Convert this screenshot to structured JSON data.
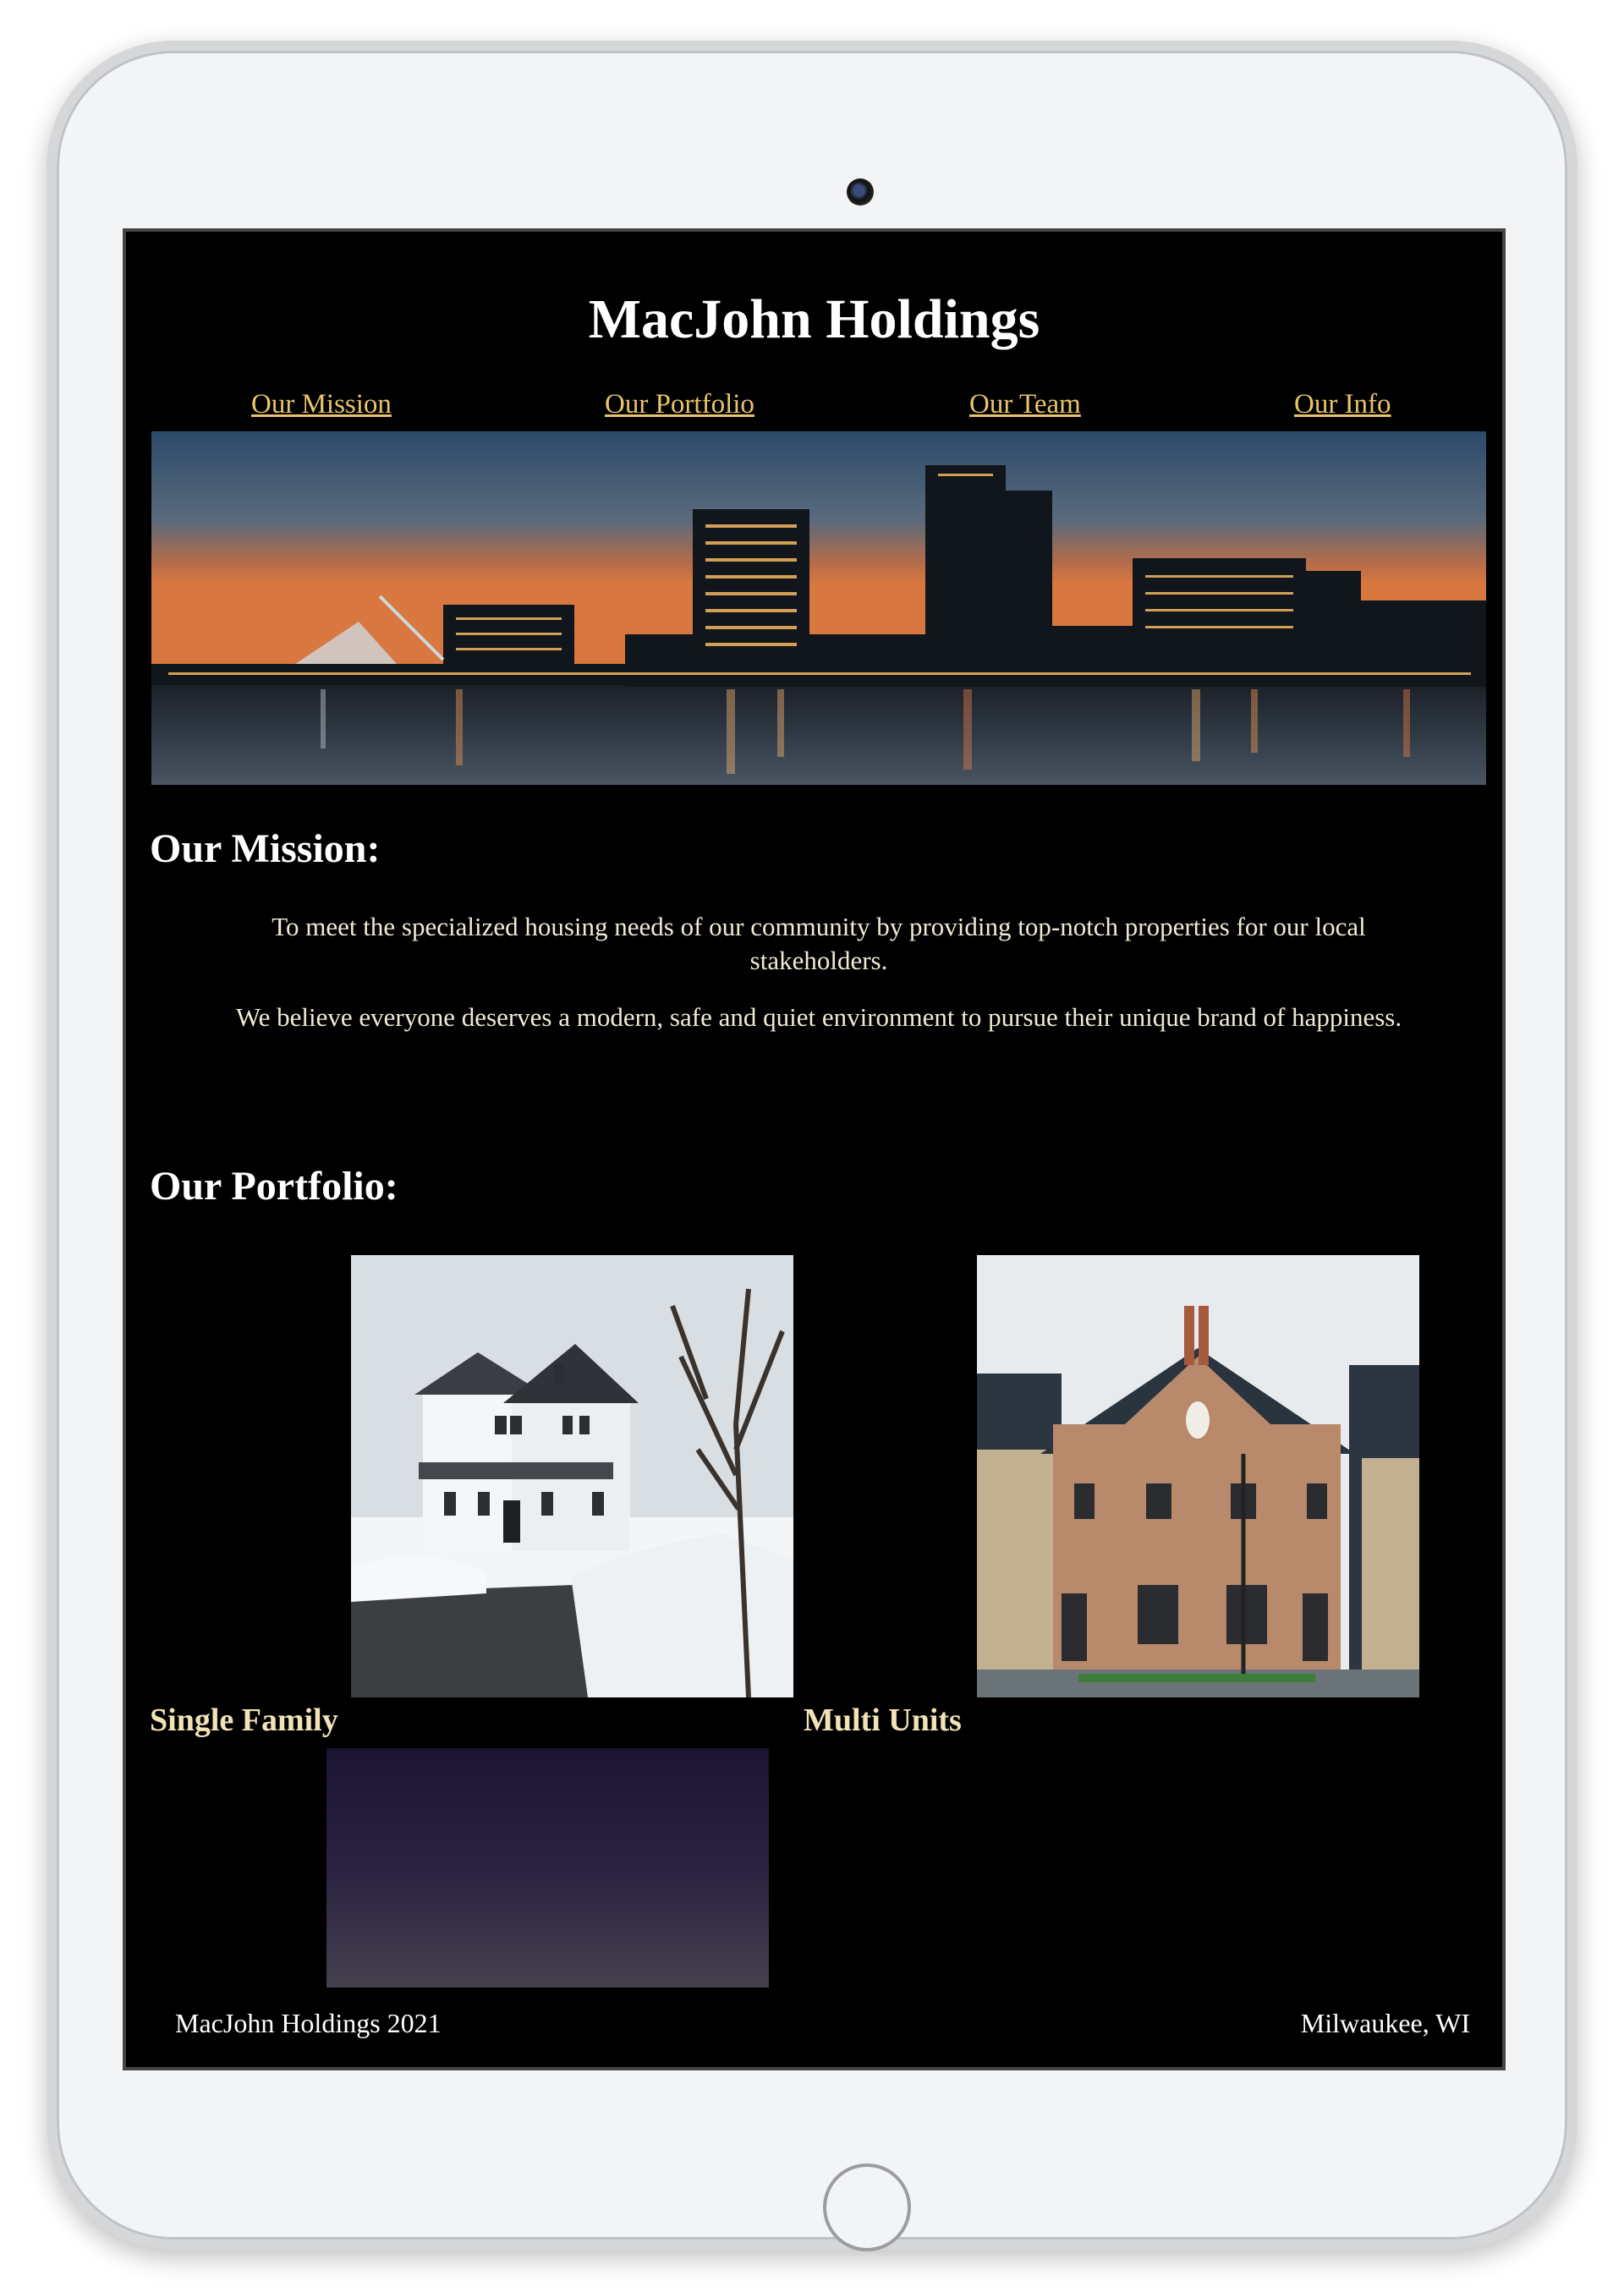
{
  "site": {
    "title": "MacJohn Holdings"
  },
  "nav": {
    "items": [
      {
        "label": "Our Mission"
      },
      {
        "label": "Our Portfolio"
      },
      {
        "label": "Our Team"
      },
      {
        "label": "Our Info"
      }
    ]
  },
  "mission": {
    "heading": "Our Mission:",
    "paragraph1": "To meet the specialized housing needs of our community by providing top-notch properties for our local stakeholders.",
    "paragraph2": "We believe everyone deserves a modern, safe and quiet environment to pursue their unique brand of happiness."
  },
  "portfolio": {
    "heading": "Our Portfolio:",
    "items": [
      {
        "label": "Single Family"
      },
      {
        "label": "Multi Units"
      }
    ]
  },
  "footer": {
    "left": "MacJohn Holdings 2021",
    "right": "Milwaukee, WI"
  },
  "colors": {
    "page_background": "#000000",
    "link": "#e9c46a",
    "heading": "#ffffff",
    "body_text": "#f0ead6",
    "portfolio_label": "#f2e3b6"
  }
}
